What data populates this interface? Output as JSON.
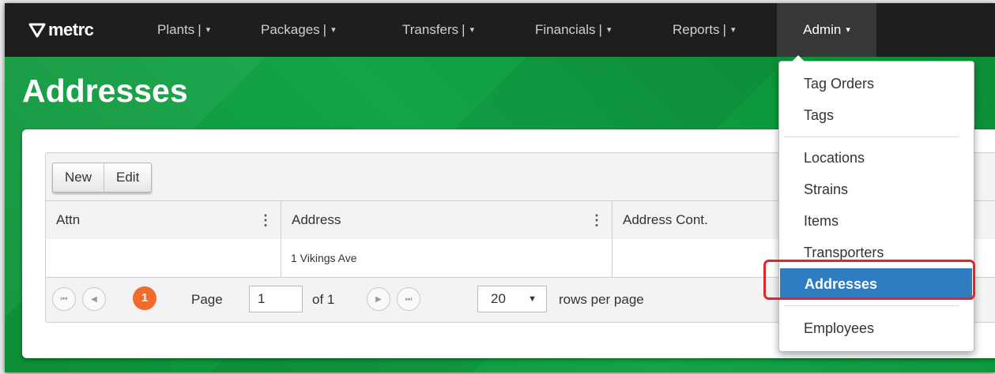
{
  "navbar": {
    "logo": "metrc",
    "items": [
      {
        "label": "Plants",
        "sep": "|"
      },
      {
        "label": "Packages",
        "sep": "|"
      },
      {
        "label": "Transfers",
        "sep": "|"
      },
      {
        "label": "Financials",
        "sep": "|"
      },
      {
        "label": "Reports",
        "sep": "|"
      }
    ],
    "admin": "Admin"
  },
  "page": {
    "title": "Addresses"
  },
  "toolbar": {
    "new_label": "New",
    "edit_label": "Edit"
  },
  "table": {
    "columns": [
      "Attn",
      "Address",
      "Address Cont."
    ],
    "rows": [
      {
        "attn": "",
        "address": "1 Vikings Ave",
        "address_cont": ""
      }
    ]
  },
  "pager": {
    "current_page_badge": "1",
    "page_label": "Page",
    "page_value": "1",
    "of_label": "of 1",
    "rows_value": "20",
    "rows_label": "rows per page"
  },
  "admin_menu": {
    "items": [
      "Tag Orders",
      "Tags",
      "Locations",
      "Strains",
      "Items",
      "Transporters",
      "Addresses",
      "Employees"
    ],
    "active": "Addresses"
  },
  "colors": {
    "brand_green": "#0d9a3c",
    "navbar": "#1e1e1e",
    "active_blue": "#2f7cc0",
    "page_orange": "#f06b2c",
    "highlight_red": "#e0262c"
  }
}
